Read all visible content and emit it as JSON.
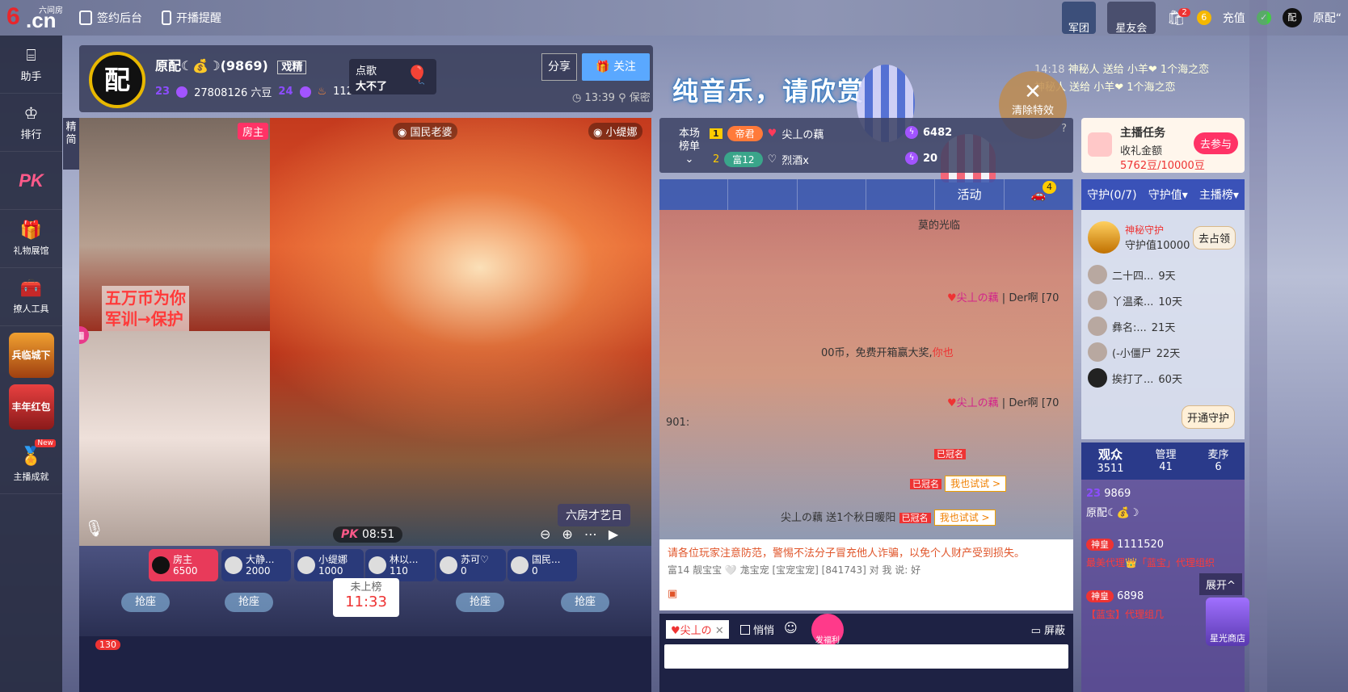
{
  "topbar": {
    "logo_big": "6",
    "logo_cn": ".cn",
    "logo_small": "六间房",
    "sign_backend": "签约后台",
    "live_remind": "开播提醒",
    "corps": "军团",
    "star_club": "星友会",
    "notify_count": "2",
    "recharge": "充值",
    "user_name": "原配“"
  },
  "leftbar": {
    "assistant": "助手",
    "ranking": "排行",
    "pk": "PK",
    "gift_hall": "礼物展馆",
    "prop": "撩人工具",
    "game1": "兵临城下",
    "game2": "丰年红包",
    "achievement": "主播成就",
    "new_badge": "New"
  },
  "anchor": {
    "avatar_text": "配",
    "name": "原配☾💰☽(9869)",
    "badge": "戏精",
    "level_left": "23",
    "beans": "27808126 六豆",
    "level_right": "24",
    "fans": "1122",
    "song_label": "点歌",
    "song_value": "大不了",
    "share": "分享",
    "follow": "关注",
    "time": "13:39",
    "privacy": "保密"
  },
  "banner": {
    "text": "纯音乐，请欣赏"
  },
  "gift_feed": [
    "神秘人 送给 小羊❤ 1个海之恋",
    "神秘人 送给 小羊❤ 1个海之恋"
  ],
  "gift_feed_time": "14:18",
  "clear_effects": {
    "x": "✕",
    "label": "清除特效"
  },
  "video": {
    "host_badge": "房主",
    "cam_label1": "国民老婆",
    "cam_label2": "小缇娜",
    "side_label": "精简",
    "promo_line1": "五万币为你",
    "promo_line2": "军训→保护",
    "room_label": "六房才艺日",
    "pk_time": "08:51"
  },
  "seats": [
    {
      "name": "房主",
      "value": "6500"
    },
    {
      "name": "大静...",
      "value": "2000"
    },
    {
      "name": "小缇娜",
      "value": "1000"
    },
    {
      "name": "林以...",
      "value": "110"
    },
    {
      "name": "苏可♡",
      "value": "0"
    },
    {
      "name": "国民...",
      "value": "0"
    }
  ],
  "grab_label": "抢座",
  "not_listed": {
    "label": "未上榜",
    "time": "11:33"
  },
  "bottom_count": "130",
  "rankbar": {
    "title1": "本场",
    "title2": "榜单",
    "r1_num": "1",
    "r1_badge": "帝君",
    "r1_name": "尖丄の藕",
    "r1_score": "6482",
    "r2_num": "2",
    "r2_badge": "富12",
    "r2_name": "烈酒x",
    "r2_score": "20"
  },
  "chat_tabs": [
    "",
    "",
    "",
    "",
    "活动",
    ""
  ],
  "car_count": "4",
  "chat": {
    "line1": "莫的光临",
    "line2_name": "尖丄の藕",
    "line2_tail": "Der啊 [70",
    "line3": "00币，免费开箱赢大奖,",
    "line3_red": "你也",
    "line4_name": "尖丄の藕",
    "line4_tail": "Der啊 [70",
    "line5": "901:",
    "tag_name": "已冠名",
    "try": "我也试试 >",
    "line7": "尖丄の藕 送1个秋日暖阳"
  },
  "warning": "请各位玩家注意防范，警惕不法分子冒充他人诈骗，以免个人财产受到损失。",
  "warning_sub": "富14 靓宝宝 🤍 尨宝宠 [宝宠宝宠] [841743] 对 我 说: 好",
  "input": {
    "target": "尖丄の",
    "whisper": "悄悄",
    "block": "屏蔽",
    "gift_label": "发福利"
  },
  "task": {
    "title": "主播任务",
    "sub": "收礼金额",
    "progress": "5762豆/10000豆",
    "join": "去参与"
  },
  "guard": {
    "tab1": "守护(0/7)",
    "tab2": "守护值▾",
    "tab3": "主播榜▾",
    "top_name": "神秘守护",
    "top_value": "守护值10000",
    "occupy": "去占领",
    "rows": [
      {
        "name": "二十四...",
        "days": "9天"
      },
      {
        "name": "丫温柔...",
        "days": "10天"
      },
      {
        "name": "彝名:...",
        "days": "21天"
      },
      {
        "name": "(-小僵尸",
        "days": "22天"
      },
      {
        "name": "挨打了...",
        "days": "60天"
      }
    ],
    "open": "开通守护"
  },
  "audience": {
    "viewers_label": "观众",
    "viewers": "3511",
    "admin_label": "管理",
    "admin": "41",
    "mic_label": "麦序",
    "mic": "6"
  },
  "aud_list": {
    "self_level": "23",
    "self_id": "9869",
    "self_name": "原配☾💰☽",
    "u1_badge": "神皇",
    "u1_id": "1111520",
    "u1_slogan": "最美代理👑「蓝宝」代理组织",
    "u2_badge": "神皇",
    "u2_id": "6898",
    "u2_slogan": "【蓝宝】代理组几"
  },
  "expand": "展开^",
  "star_shop": "星光商店"
}
